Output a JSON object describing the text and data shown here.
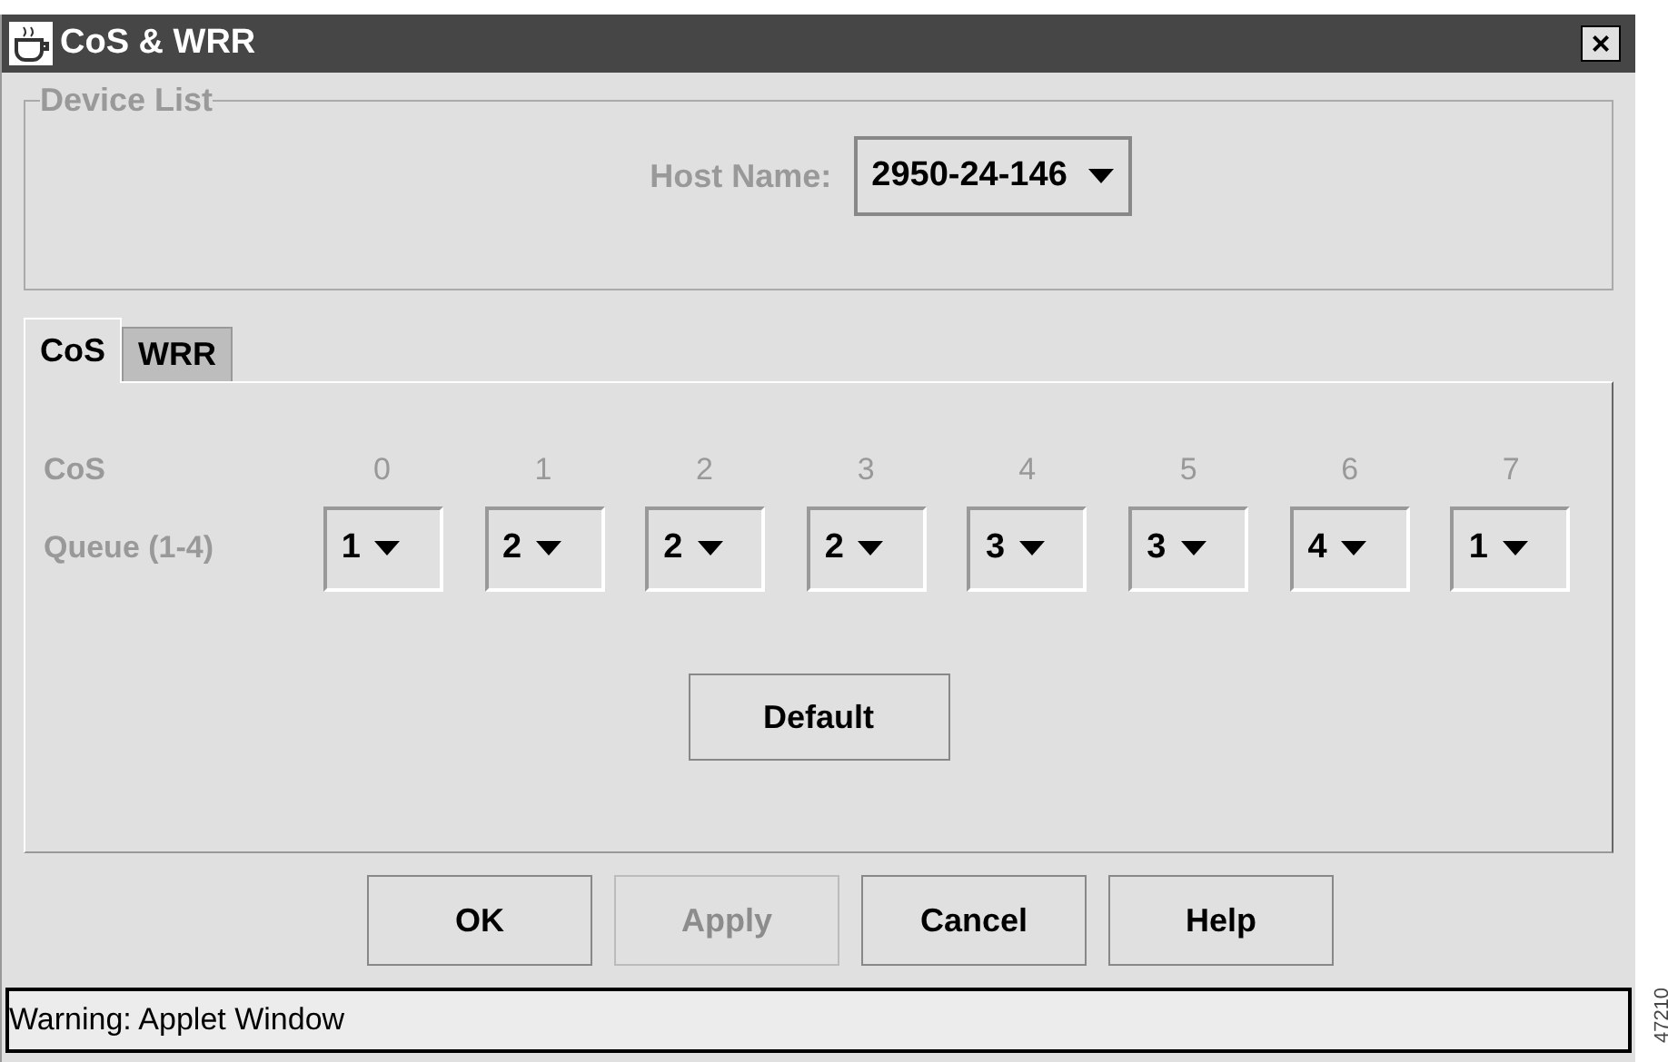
{
  "window": {
    "title": "CoS & WRR",
    "close": "×"
  },
  "device_list": {
    "legend": "Device List",
    "host_label": "Host Name:",
    "host_value": "2950-24-146"
  },
  "tabs": [
    {
      "label": "CoS",
      "selected": true
    },
    {
      "label": "WRR",
      "selected": false
    }
  ],
  "cos_table": {
    "row_label": "CoS",
    "queue_label": "Queue (1-4)",
    "columns": [
      {
        "cos": "0",
        "queue": "1"
      },
      {
        "cos": "1",
        "queue": "2"
      },
      {
        "cos": "2",
        "queue": "2"
      },
      {
        "cos": "3",
        "queue": "2"
      },
      {
        "cos": "4",
        "queue": "3"
      },
      {
        "cos": "5",
        "queue": "3"
      },
      {
        "cos": "6",
        "queue": "4"
      },
      {
        "cos": "7",
        "queue": "1"
      }
    ]
  },
  "default_button": "Default",
  "buttons": [
    {
      "label": "OK",
      "disabled": false
    },
    {
      "label": "Apply",
      "disabled": true
    },
    {
      "label": "Cancel",
      "disabled": false
    },
    {
      "label": "Help",
      "disabled": false
    }
  ],
  "status_bar": "Warning: Applet Window",
  "figure_id": "47210"
}
